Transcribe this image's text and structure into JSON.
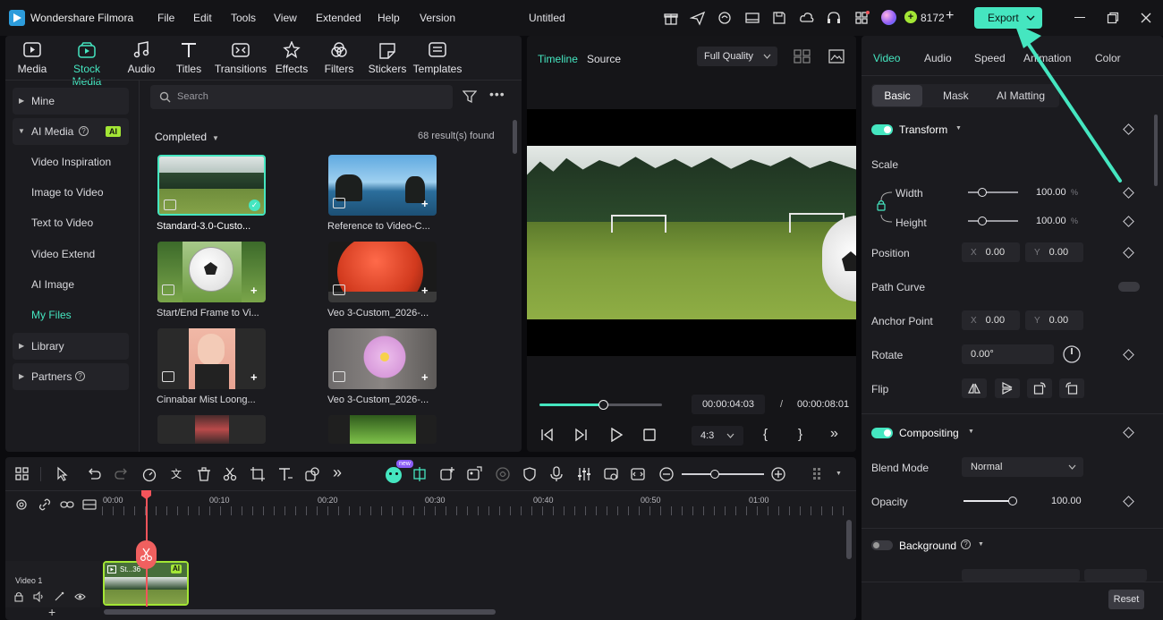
{
  "app": {
    "name": "Wondershare Filmora",
    "project_title": "Untitled"
  },
  "menu": [
    "File",
    "Edit",
    "Tools",
    "View",
    "Extended",
    "Help",
    "Version"
  ],
  "credits": "8172",
  "export_label": "Export",
  "toolbar": [
    {
      "label": "Media",
      "icon": "media-icon"
    },
    {
      "label": "Stock Media",
      "icon": "stock-media-icon",
      "active": true
    },
    {
      "label": "Audio",
      "icon": "audio-icon"
    },
    {
      "label": "Titles",
      "icon": "titles-icon"
    },
    {
      "label": "Transitions",
      "icon": "transitions-icon"
    },
    {
      "label": "Effects",
      "icon": "effects-icon"
    },
    {
      "label": "Filters",
      "icon": "filters-icon"
    },
    {
      "label": "Stickers",
      "icon": "stickers-icon"
    },
    {
      "label": "Templates",
      "icon": "templates-icon"
    }
  ],
  "sidebar": {
    "mine": "Mine",
    "ai_media": "AI Media",
    "ai_badge": "AI",
    "sub": [
      "Video Inspiration",
      "Image to Video",
      "Text to Video",
      "Video Extend",
      "AI Image",
      "My Files"
    ],
    "library": "Library",
    "partners": "Partners"
  },
  "search": {
    "placeholder": "Search"
  },
  "results": {
    "filter": "Completed",
    "count": "68 result(s) found"
  },
  "media_items": [
    "Standard-3.0-Custo...",
    "Reference to Video-C...",
    "Start/End Frame to Vi...",
    "Veo 3-Custom_2026-...",
    "Cinnabar Mist Loong...",
    "Veo 3-Custom_2026-..."
  ],
  "preview": {
    "tabs": [
      "Timeline",
      "Source"
    ],
    "quality": "Full Quality",
    "current_time": "00:00:04:03",
    "separator": "/",
    "total_time": "00:00:08:01",
    "aspect": "4:3",
    "progress": 0.52
  },
  "right_panel": {
    "tabs": [
      "Video",
      "Audio",
      "Speed",
      "Animation",
      "Color"
    ],
    "subtabs": [
      "Basic",
      "Mask",
      "AI Matting"
    ],
    "transform": "Transform",
    "scale": "Scale",
    "width": {
      "label": "Width",
      "value": "100.00",
      "unit": "%"
    },
    "height": {
      "label": "Height",
      "value": "100.00",
      "unit": "%"
    },
    "position": {
      "label": "Position",
      "x": "0.00",
      "y": "0.00",
      "x_prefix": "X",
      "y_prefix": "Y"
    },
    "path_curve": "Path Curve",
    "anchor": {
      "label": "Anchor Point",
      "x": "0.00",
      "y": "0.00"
    },
    "rotate": {
      "label": "Rotate",
      "value": "0.00°"
    },
    "flip": "Flip",
    "compositing": "Compositing",
    "blend_mode": {
      "label": "Blend Mode",
      "value": "Normal"
    },
    "opacity": {
      "label": "Opacity",
      "value": "100.00"
    },
    "background": "Background",
    "reset": "Reset"
  },
  "timeline": {
    "ruler": [
      "00:00",
      "00:10",
      "00:20",
      "00:30",
      "00:40",
      "00:50",
      "01:00"
    ],
    "track_label": "Video 1",
    "clip_label": "St...36",
    "clip_badge": "AI",
    "new_badge": "new"
  },
  "colors": {
    "accent": "#45e6c0",
    "playhead": "#f2545b",
    "panel": "#1b1b1f"
  }
}
